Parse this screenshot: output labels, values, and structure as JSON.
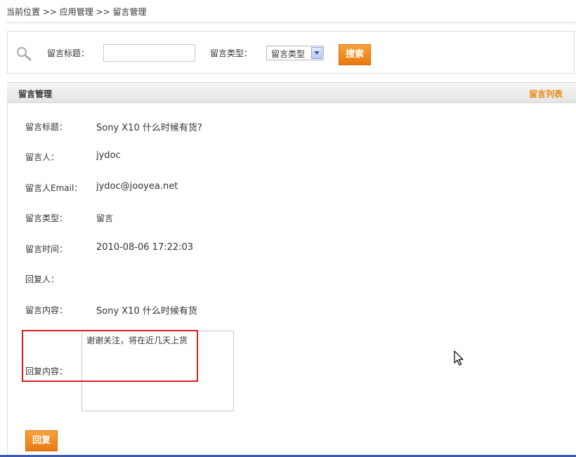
{
  "breadcrumb": "当前位置 >> 应用管理 >> 留言管理",
  "search": {
    "title_label": "留言标题：",
    "title_value": "",
    "type_label": "留言类型：",
    "type_selected": "留言类型",
    "search_button": "搜索"
  },
  "panel": {
    "title": "留言管理",
    "list_link": "留言列表"
  },
  "details": {
    "title_label": "留言标题：",
    "title_value": "Sony X10 什么时候有货?",
    "author_label": "留言人：",
    "author_value": "jydoc",
    "email_label": "留言人Email：",
    "email_value": "jydoc@jooyea.net",
    "type_label": "留言类型：",
    "type_value": "留言",
    "time_label": "留言时间：",
    "time_value": "2010-08-06 17:22:03",
    "replier_label": "回复人：",
    "replier_value": "",
    "content_label": "留言内容：",
    "content_value": "Sony X10 什么时候有货",
    "reply_label": "回复内容：",
    "reply_value": "谢谢关注，将在近几天上货"
  },
  "reply_button": "回复",
  "colors": {
    "accent_orange": "#e77a10",
    "link_orange": "#e68a14",
    "highlight_red": "#d91d1d"
  }
}
